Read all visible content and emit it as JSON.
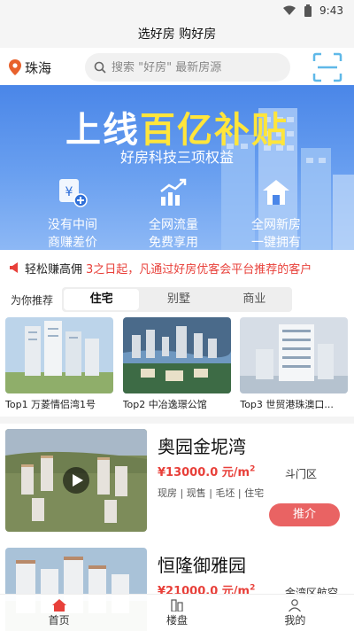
{
  "status_bar": {
    "time": "9:43"
  },
  "header": {
    "title": "选好房 购好房"
  },
  "search": {
    "city": "珠海",
    "placeholder": "搜索 \"好房\" 最新房源"
  },
  "banner": {
    "title_part1": "上线",
    "title_highlight": "百亿补贴",
    "subtitle": "好房科技三项权益",
    "benefits": [
      {
        "line1": "没有中间",
        "line2": "商赚差价",
        "icon": "yen-plus-icon"
      },
      {
        "line1": "全网流量",
        "line2": "免费享用",
        "icon": "rising-chart-icon"
      },
      {
        "line1": "全网新房",
        "line2": "一键拥有",
        "icon": "house-icon"
      }
    ]
  },
  "notice": {
    "label": "轻松赚高佣",
    "message": "3之日起，凡通过好房优客会平台推荐的客户"
  },
  "recommend": {
    "label": "为你推荐",
    "tabs": [
      "住宅",
      "别墅",
      "商业"
    ],
    "active": 0
  },
  "top_picks": [
    {
      "caption": "Top1 万菱情侣湾1号"
    },
    {
      "caption": "Top2 中冶逸璟公馆"
    },
    {
      "caption": "Top3 世贸港珠澳口..."
    }
  ],
  "listings": [
    {
      "name": "奥园金坭湾",
      "price": "¥13000.0 元/m",
      "price_sup": "2",
      "district": "斗门区",
      "tags": "现房 | 现售 | 毛坯 | 住宅",
      "action": "推介",
      "has_video": true
    },
    {
      "name": "恒隆御雅园",
      "price": "¥21000.0 元/m",
      "price_sup": "2",
      "district": "金湾区航空",
      "tags": "",
      "action": "",
      "has_video": false
    }
  ],
  "bottom_nav": [
    {
      "label": "首页",
      "active": true
    },
    {
      "label": "楼盘",
      "active": false
    },
    {
      "label": "我的",
      "active": false
    }
  ],
  "colors": {
    "accent_red": "#e8403a",
    "button_red": "#e96363",
    "banner_blue": "#4a86e8",
    "highlight_yellow": "#ffe53b"
  }
}
